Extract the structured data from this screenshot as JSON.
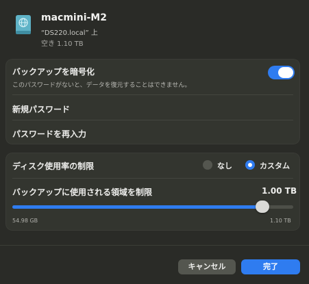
{
  "disk": {
    "name": "macmini-M2",
    "location": "“DS220.local” 上",
    "free": "空き 1.10 TB"
  },
  "encryption": {
    "title": "バックアップを暗号化",
    "description": "このパスワードがないと、データを復元することはできません。",
    "enabled": true,
    "new_password_label": "新規パスワード",
    "reenter_password_label": "パスワードを再入力"
  },
  "disk_limit": {
    "title": "ディスク使用率の制限",
    "options": [
      {
        "label": "なし",
        "selected": false
      },
      {
        "label": "カスタム",
        "selected": true
      }
    ],
    "limit_label": "バックアップに使用される領域を制限",
    "limit_value": "1.00 TB",
    "slider_level": 0.89,
    "min_label": "54.98 GB",
    "max_label": "1.10 TB"
  },
  "buttons": {
    "cancel": "キャンセル",
    "done": "完了"
  },
  "colors": {
    "accent": "#2f7cf0",
    "background": "#2a2b27",
    "card": "#33352f"
  }
}
